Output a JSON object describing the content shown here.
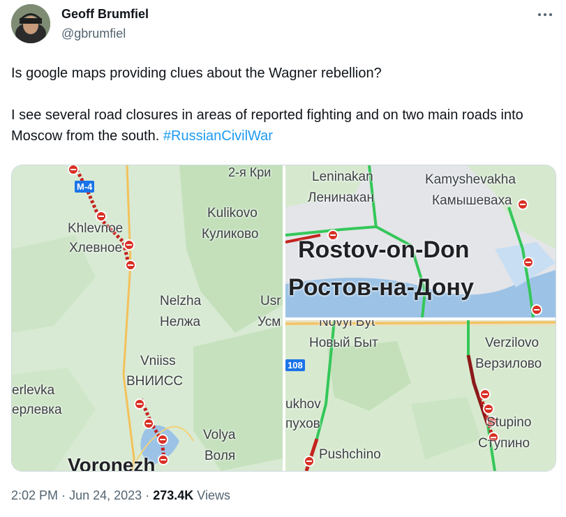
{
  "author": {
    "name": "Geoff Brumfiel",
    "handle": "@gbrumfiel"
  },
  "tweet": {
    "line1": "Is google maps providing clues about the Wagner rebellion?",
    "line2": "I see several road closures in areas of reported fighting and on two main roads into Moscow from the south.",
    "hashtag": "#RussianCivilWar"
  },
  "maps": {
    "voronezh": {
      "route": "M-4",
      "labels": [
        "2-я Кри",
        "Kulikovo",
        "Куликово",
        "Khlevnoe",
        "Хлевное",
        "Nelzha",
        "Нелжа",
        "Usr",
        "Усм",
        "Vniiss",
        "ВНИИСС",
        "erlevka",
        "ерлевка",
        "Volya",
        "Воля",
        "Voronezh"
      ]
    },
    "rostov": {
      "labels": [
        "Leninakan",
        "Ленинакан",
        "Kamyshevakha",
        "Камышеваха",
        "Rostov-on-Don",
        "Ростов-на-Дону"
      ]
    },
    "stupino": {
      "route": "108",
      "labels": [
        "Novyi Byt",
        "Новый Быт",
        "Verzilovo",
        "Верзилово",
        "ukhov",
        "пухов",
        "Stupino",
        "Ступино",
        "Pushchino"
      ]
    }
  },
  "meta": {
    "time": "2:02 PM",
    "date": "Jun 24, 2023",
    "separator": "·",
    "views_count": "273.4K",
    "views_label": "Views"
  },
  "colors": {
    "accent": "#1d9bf0",
    "closure": "#d93025",
    "traffic_green": "#34c759",
    "route_shield": "#1a73e8"
  },
  "icons": [
    "more-icon",
    "road-closed-icon"
  ]
}
